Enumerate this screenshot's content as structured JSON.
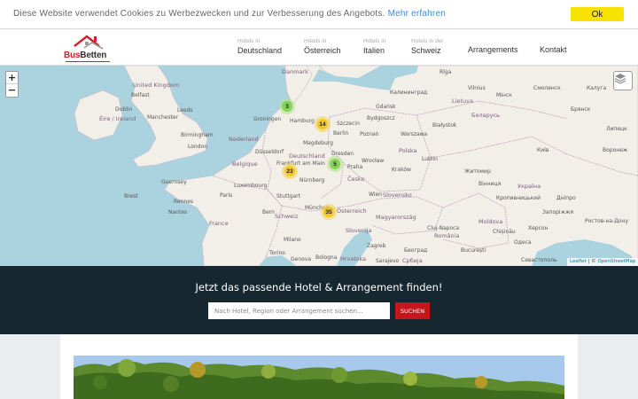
{
  "cookie": {
    "text": "Diese Website verwendet Cookies zu Werbezwecken und zur Verbesserung des Angebots.",
    "link": "Mehr erfahren",
    "ok_label": "Ok",
    "button_color": "#f7e200"
  },
  "header": {
    "logo": {
      "part1": "Bus",
      "part2": "Betten",
      "brand_color": "#d0222a"
    },
    "nav": [
      {
        "small": "Hotels in",
        "label": "Deutschland"
      },
      {
        "small": "Hotels in",
        "label": "Österreich"
      },
      {
        "small": "Hotels in",
        "label": "Italien"
      },
      {
        "small": "Hotels in der",
        "label": "Schweiz"
      },
      {
        "label": "Arrangements"
      },
      {
        "label": "Kontakt"
      }
    ]
  },
  "map": {
    "zoom_in": "+",
    "zoom_out": "−",
    "clusters": [
      "3",
      "14",
      "5",
      "23",
      "35"
    ],
    "labels": {
      "danmark": "Danmark",
      "uk": "United Kingdom",
      "ireland": "Éire / Ireland",
      "nederland": "Nederland",
      "belgique": "Belgique",
      "deutschland": "Deutschland",
      "luxembourg": "Luxembourg",
      "france": "France",
      "schweiz": "Schweiz",
      "oesterreich": "Österreich",
      "cesko": "Česko",
      "polska": "Polska",
      "slovensko": "Slovensko",
      "magyarorszag": "Magyarország",
      "romania": "România",
      "slovenija": "Slovenija",
      "hrvatska": "Hrvatska",
      "srbija": "Србија",
      "belarus": "Беларусь",
      "lietuva": "Lietuva",
      "ukraina": "Україна",
      "moldova": "Moldova",
      "guernsey": "Guernsey",
      "hamburg": "Hamburg",
      "berlin": "Berlin",
      "praha": "Praha",
      "wien": "Wien",
      "munchen": "München",
      "frankfurt": "Frankfurt am Main",
      "warszawa": "Warszawa",
      "london": "London",
      "paris": "Paris",
      "milano": "Milano",
      "kyiv": "Київ",
      "minsk": "Мінск",
      "belfast": "Belfast",
      "dublin": "Dublin",
      "manchester": "Manchester",
      "leeds": "Leeds",
      "birmingham": "Birmingham",
      "groningen": "Groningen",
      "gdansk": "Gdańsk",
      "kaliningrad": "Калининград",
      "bydgoszcz": "Bydgoszcz",
      "poznan": "Poznań",
      "wroclaw": "Wrocław",
      "krakow": "Kraków",
      "lublin": "Lublin",
      "bialystok": "Białystok",
      "magdeburg": "Magdeburg",
      "dresden": "Dresden",
      "nurnberg": "Nürnberg",
      "stuttgart": "Stuttgart",
      "dusseldorf": "Düsseldorf",
      "szczecin": "Szczecin",
      "brest": "Brest",
      "rennes": "Rennes",
      "nantes": "Nantes",
      "bern": "Bern",
      "torino": "Torino",
      "genova": "Genova",
      "bologna": "Bologna",
      "zagreb": "Zagreb",
      "sarajevo": "Sarajevo",
      "beograd": "Београд",
      "bucuresti": "București",
      "cluj": "Cluj-Napoca",
      "chisinau": "Chișinău",
      "odesa": "Одеса",
      "sevastopol": "Севастополь",
      "kherson": "Херсон",
      "zaporizhzhia": "Запоріжжя",
      "dnipro": "Дніпро",
      "zhytomyr": "Житомир",
      "vinnytsia": "Вінниця",
      "kropyvnytskyi": "Кропивницький",
      "kaluga": "Калуга",
      "bryansk": "Брянск",
      "lipetsk": "Липецк",
      "voronezh": "Воронеж",
      "rostov": "Ростов-на-Дону",
      "smolensk": "Смоленск",
      "riga": "Rīga",
      "vilnius": "Vilnius"
    },
    "attribution_leaflet": "Leaflet",
    "attribution_sep": " | © ",
    "attribution_osm": "OpenStreetMap"
  },
  "search": {
    "title": "Jetzt das passende Hotel & Arrangement finden!",
    "placeholder": "Nach Hotel, Region oder Arrangement suchen...",
    "button": "SUCHEN",
    "button_color": "#c4161c"
  }
}
